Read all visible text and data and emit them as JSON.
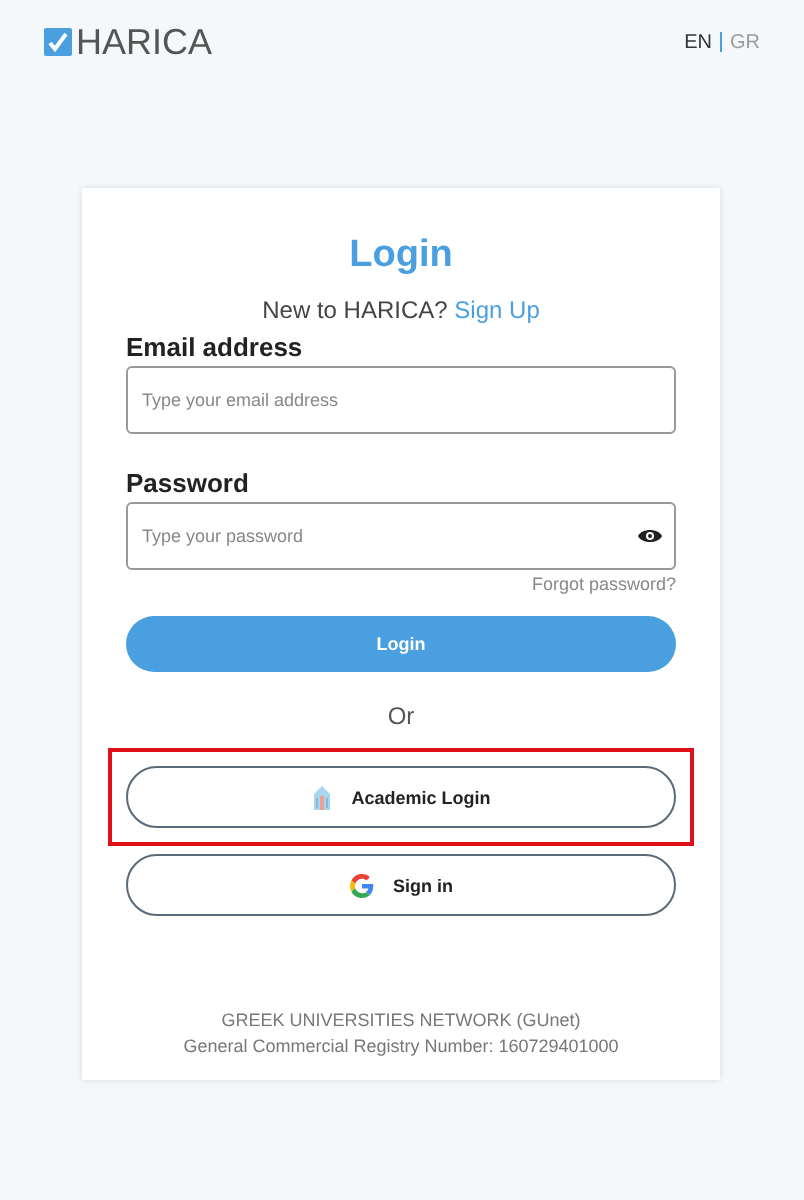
{
  "header": {
    "logo": "HARICA",
    "languages": [
      {
        "label": "EN",
        "selected": true
      },
      {
        "label": "GR",
        "selected": false
      }
    ]
  },
  "login": {
    "title": "Login",
    "signup_prompt": "New to HARICA?",
    "signup_link": "Sign Up",
    "fields": [
      {
        "label": "Email address",
        "placeholder": "Type your email address",
        "kind": "text"
      },
      {
        "label": "Password",
        "placeholder": "Type your password",
        "kind": "password"
      }
    ],
    "forgot_link": "Forgot password?",
    "submit": "Login",
    "separator": "Or",
    "alt_buttons": [
      {
        "label": "Academic Login",
        "kind": "academic",
        "highlighted": true
      },
      {
        "label": "Sign in",
        "kind": "google",
        "highlighted": false
      }
    ],
    "footer": [
      "GREEK UNIVERSITIES NETWORK (GUnet)",
      "General Commercial Registry Number: 160729401000"
    ]
  }
}
